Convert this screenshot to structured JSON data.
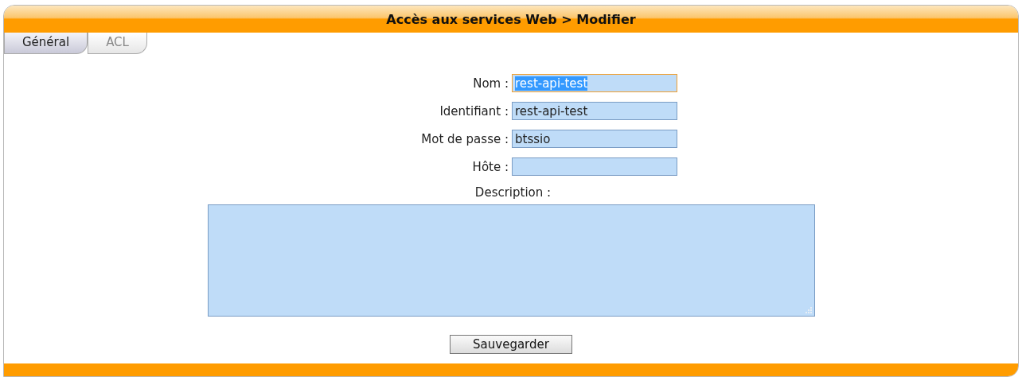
{
  "window": {
    "title": "Accès aux services Web > Modifier"
  },
  "tabs": [
    {
      "label": "Général",
      "selected": true
    },
    {
      "label": "ACL",
      "selected": false
    }
  ],
  "fields": [
    {
      "label": "Nom :",
      "value": "rest-api-test",
      "focused": true,
      "text_selected": true
    },
    {
      "label": "Identifiant :",
      "value": "rest-api-test",
      "focused": false,
      "text_selected": false
    },
    {
      "label": "Mot de passe :",
      "value": "btssio",
      "focused": false,
      "text_selected": false
    },
    {
      "label": "Hôte :",
      "focused": false
    }
  ],
  "description": {
    "label": "Description :"
  },
  "save_button": "Sauvegarder"
}
